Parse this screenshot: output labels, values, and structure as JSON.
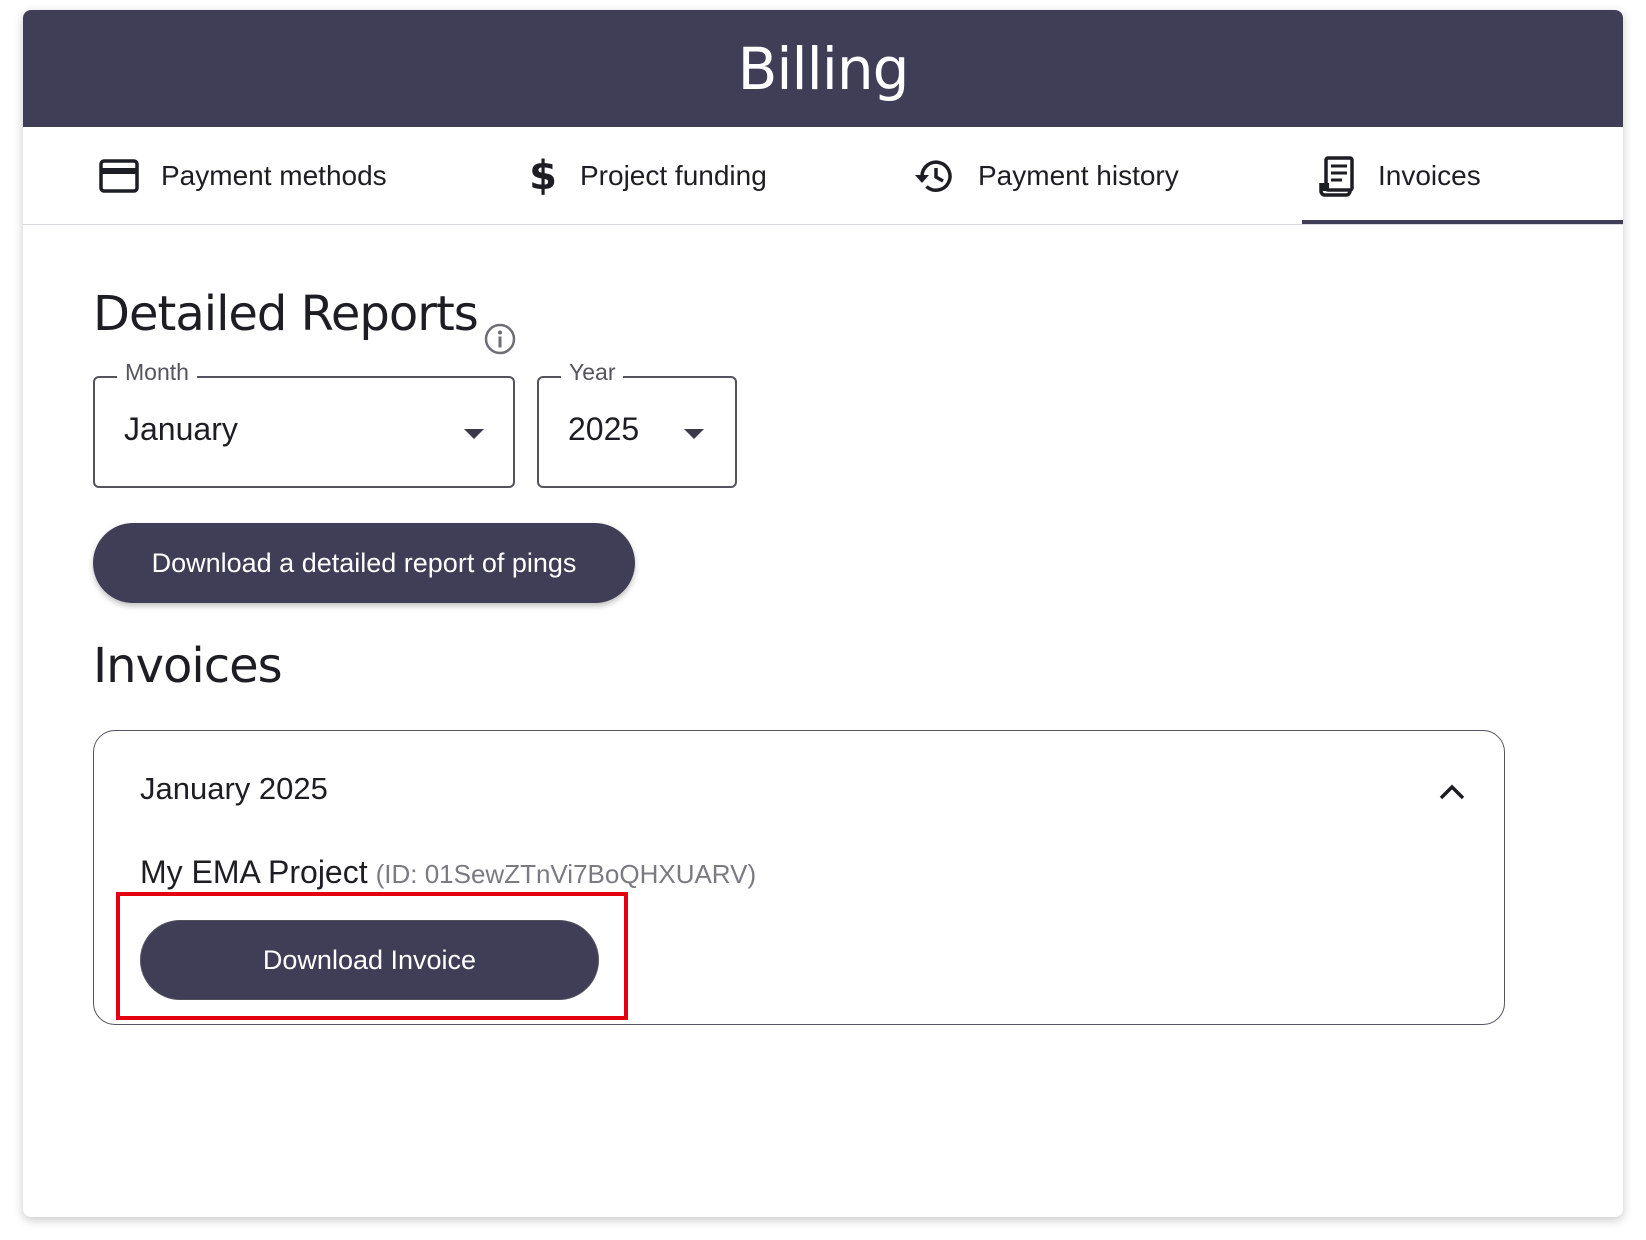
{
  "header": {
    "title": "Billing"
  },
  "tabs": [
    {
      "label": "Payment methods",
      "icon": "credit-card-icon",
      "selected": false
    },
    {
      "label": "Project funding",
      "icon": "dollar-icon",
      "selected": false
    },
    {
      "label": "Payment history",
      "icon": "history-icon",
      "selected": false
    },
    {
      "label": "Invoices",
      "icon": "receipt-icon",
      "selected": true
    }
  ],
  "reports": {
    "title": "Detailed Reports",
    "month": {
      "label": "Month",
      "value": "January"
    },
    "year": {
      "label": "Year",
      "value": "2025"
    },
    "download_label": "Download a detailed report of pings"
  },
  "invoices": {
    "title": "Invoices",
    "period": "January 2025",
    "project_name": "My EMA Project",
    "project_id": "(ID: 01SewZTnVi7BoQHXUARV)",
    "download_label": "Download Invoice"
  },
  "colors": {
    "primary": "#403d57",
    "highlight": "#e3000f"
  }
}
